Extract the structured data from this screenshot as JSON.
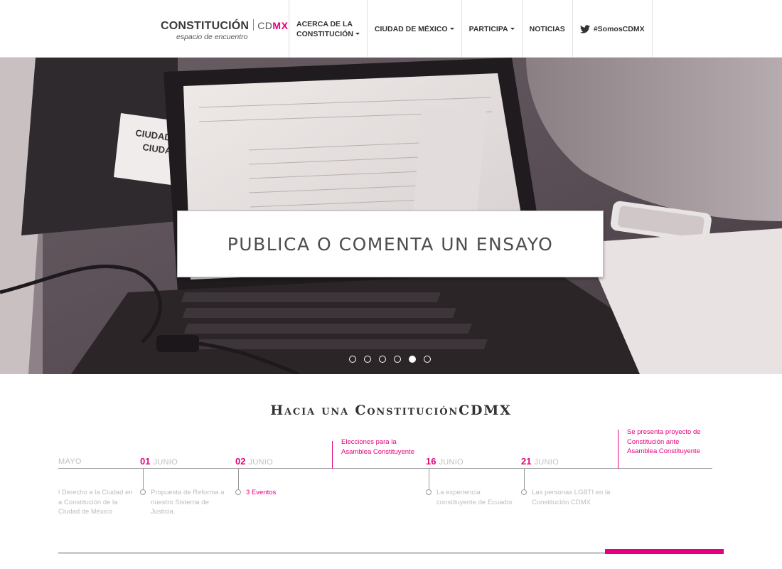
{
  "header": {
    "logo_main": "CONSTITUCIÓN",
    "logo_city_prefix": "CD",
    "logo_city_accent": "MX",
    "logo_tagline": "espacio de encuentro",
    "nav": [
      {
        "label_line1": "ACERCA DE LA",
        "label_line2": "CONSTITUCIÓN"
      },
      {
        "label": "CIUDAD DE MÉXICO"
      },
      {
        "label": "PARTICIPA"
      },
      {
        "label": "NOTICIAS"
      },
      {
        "label": "#SomosCDMX",
        "icon": "twitter-icon"
      }
    ]
  },
  "hero": {
    "caption": "PUBLICA O COMENTA UN ENSAYO",
    "slides_total": 6,
    "active_slide": 5,
    "image_text_sign_line1": "CIUDAD P",
    "image_text_sign_line2": "CIUDAD"
  },
  "timeline": {
    "title": "Hacia una ConstituciónCDMX",
    "dates": [
      {
        "num": "",
        "month": "MAYO"
      },
      {
        "num": "01",
        "month": "JUNIO"
      },
      {
        "num": "02",
        "month": "JUNIO"
      },
      {
        "num": "16",
        "month": "JUNIO"
      },
      {
        "num": "21",
        "month": "JUNIO"
      }
    ],
    "events": [
      {
        "line1": "l Derecho a la Ciudad en",
        "line2": "a Constitución de la",
        "line3": "Ciudad de México"
      },
      {
        "line1": "Propuesta de Reforma a",
        "line2": "nuestro Sistema de",
        "line3": "Justicia."
      },
      {
        "line1": "3 Eventos"
      },
      {
        "line1": "La experiencia",
        "line2": "constituyente de Ecuador"
      },
      {
        "line1": "Las personas LGBTI en la",
        "line2": "Constitución CDMX"
      }
    ],
    "milestones": [
      {
        "line1": "Elecciones para la",
        "line2": "Asamblea Constituyente"
      },
      {
        "line1": "Se presenta proyecto de",
        "line2": "Constitución ante",
        "line3": "Asamblea Constituyente"
      }
    ]
  },
  "colors": {
    "accent": "#e5007e",
    "text": "#333333",
    "muted": "#bdbdbd"
  }
}
